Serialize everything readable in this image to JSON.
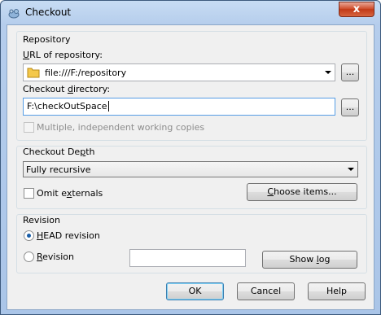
{
  "window": {
    "title": "Checkout",
    "close_label": "x"
  },
  "repository": {
    "group_title": "Repository",
    "url_label_pre": "",
    "url_label_mn": "U",
    "url_label_post": "RL of repository:",
    "url_value": "file:///F:/repository",
    "dir_label_pre": "Checkout ",
    "dir_label_mn": "d",
    "dir_label_post": "irectory:",
    "dir_value": "F:\\checkOutSpace",
    "browse_label": "...",
    "multiple_label": "Multiple, independent working copies"
  },
  "depth": {
    "group_title_pre": "Checkout De",
    "group_title_mn": "p",
    "group_title_post": "th",
    "selected": "Fully recursive",
    "omit_pre": "Omit e",
    "omit_mn": "x",
    "omit_post": "ternals",
    "choose_pre": "",
    "choose_mn": "C",
    "choose_post": "hoose items..."
  },
  "revision": {
    "group_title": "Revision",
    "head_pre": "",
    "head_mn": "H",
    "head_post": "EAD revision",
    "rev_pre": "",
    "rev_mn": "R",
    "rev_post": "evision",
    "rev_value": "",
    "showlog_pre": "Show ",
    "showlog_mn": "l",
    "showlog_post": "og"
  },
  "footer": {
    "ok": "OK",
    "cancel": "Cancel",
    "help": "Help"
  }
}
